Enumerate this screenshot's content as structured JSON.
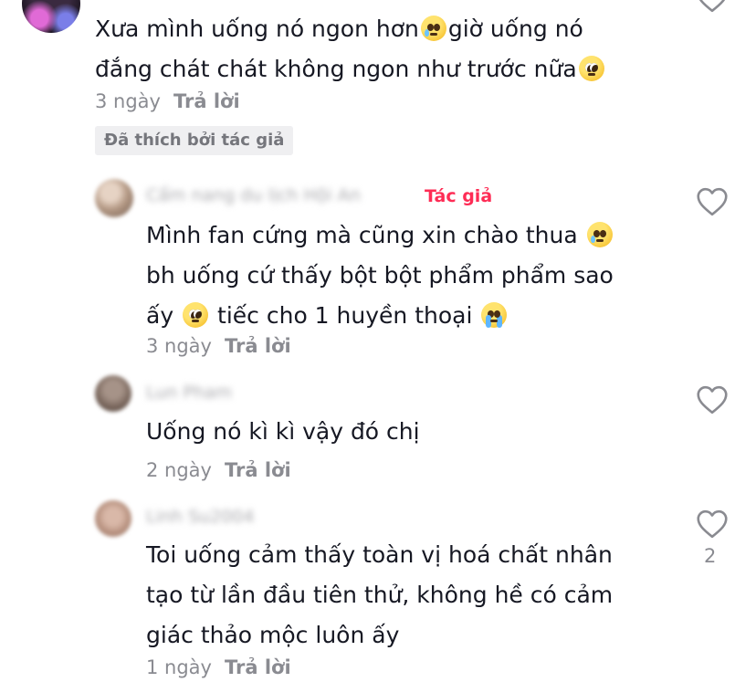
{
  "comments": [
    {
      "lines": [
        "Xưa mình uống nó ngon hơn",
        "giờ uống nó",
        "đắng chát chát không ngon như trước nữa"
      ],
      "time": "3 ngày",
      "reply": "Trả lời",
      "badge": "Đã thích bởi tác giả"
    },
    {
      "tag": "Tác giả",
      "lines": [
        "Mình fan cứng mà cũng xin chào thua",
        "bh uống cứ thấy bột bột phẩm phẩm sao",
        "ấy",
        "tiếc cho 1 huyền thoại"
      ],
      "time": "3 ngày",
      "reply": "Trả lời"
    },
    {
      "name": "Lun Pham",
      "lines": [
        "Uống nó kì kì vậy đó chị"
      ],
      "time": "2 ngày",
      "reply": "Trả lời"
    },
    {
      "name": "Linh Su2004",
      "lines": [
        "Toi uống cảm thấy toàn vị hoá chất nhân",
        "tạo từ lần đầu tiên thử, không hề có cảm",
        "giác thảo mộc luôn ấy"
      ],
      "time": "1 ngày",
      "reply": "Trả lời",
      "likes": "2"
    }
  ],
  "blurred_name_1": "Cẩm nang du lịch Hội An",
  "icons": {
    "like": "heart-outline-icon",
    "emoji_tear": "smiling-face-with-tear",
    "emoji_pleading": "pleading-face",
    "emoji_crying": "loudly-crying-face"
  },
  "colors": {
    "author_tag": "#fe2c55",
    "meta": "#8a8b91",
    "text": "#161823"
  }
}
